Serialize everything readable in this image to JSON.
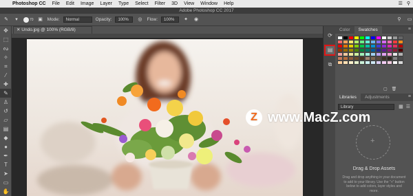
{
  "menubar": {
    "items": [
      "Photoshop CC",
      "File",
      "Edit",
      "Image",
      "Layer",
      "Type",
      "Select",
      "Filter",
      "3D",
      "View",
      "Window",
      "Help"
    ]
  },
  "window": {
    "title": "Adobe Photoshop CC 2017"
  },
  "options": {
    "brush_size": "70",
    "mode_label": "Mode:",
    "mode_value": "Normal",
    "opacity_label": "Opacity:",
    "opacity_value": "100%",
    "flow_label": "Flow:",
    "flow_value": "100%"
  },
  "document": {
    "tab_label": "Undo.jpg @ 100% (RGB/8)"
  },
  "swatches_panel": {
    "tabs": [
      "Color",
      "Swatches"
    ],
    "active_tab": "Swatches",
    "colors": [
      "#ffffff",
      "#000000",
      "#ff0000",
      "#ffff00",
      "#00ff00",
      "#00ffff",
      "#0000ff",
      "#ff00ff",
      "#ffffff",
      "#cccccc",
      "#999999",
      "#666666",
      "#ff6a6a",
      "#ffa15a",
      "#ffe86a",
      "#b4f06a",
      "#6af08a",
      "#6af0d6",
      "#6ab4f0",
      "#8a6af0",
      "#d66af0",
      "#f06ab4",
      "#ff3b3b",
      "#ff8c1a",
      "#e60000",
      "#e67300",
      "#e6cf00",
      "#7fd100",
      "#00c74a",
      "#00bfa5",
      "#0091d5",
      "#3c3cd6",
      "#8f2ad6",
      "#d62ab1",
      "#e62e5c",
      "#b30000",
      "#993300",
      "#996600",
      "#998800",
      "#4d8000",
      "#00803a",
      "#007366",
      "#005a99",
      "#26268c",
      "#5c1a8c",
      "#8c1a73",
      "#8c1a33",
      "#4d0000",
      "#f0a0a0",
      "#f0c8a0",
      "#f0e8a0",
      "#d0f0a0",
      "#a0f0b8",
      "#a0f0e0",
      "#a0d0f0",
      "#b8a0f0",
      "#e0a0f0",
      "#f0a0d0",
      "#e6e6e6",
      "#b3b3b3",
      "#c87a5a",
      "#b56a3a",
      "#8c5a3a",
      "#6b4a2a",
      "#4d3520",
      "#a0826d",
      "#7a6450",
      "#5c4a3a",
      "#3d3025",
      "#2a2018",
      "#808080",
      "#4d4d4d",
      "#ffcc99",
      "#ffe0b3",
      "#fff2cc",
      "#e6f2cc",
      "#ccf2d9",
      "#ccf2f2",
      "#cce6f2",
      "#d9ccf2",
      "#f2ccf2",
      "#f2cce0",
      "#f5f5f5",
      "#d9d9d9"
    ]
  },
  "libraries_panel": {
    "tabs": [
      "Libraries",
      "Adjustments"
    ],
    "active_tab": "Libraries",
    "library_select": "Library",
    "empty_title": "Drag & Drop Assets",
    "empty_desc": "Drag and drop anything in your document to add to your library. Use the \"+\" button below to add colors, layer styles and more."
  },
  "watermark": {
    "text": "www.MacZ.com",
    "logo_letter": "Z"
  },
  "colors": {
    "accent_red": "#e01515",
    "logo_orange": "#f26b1d"
  }
}
